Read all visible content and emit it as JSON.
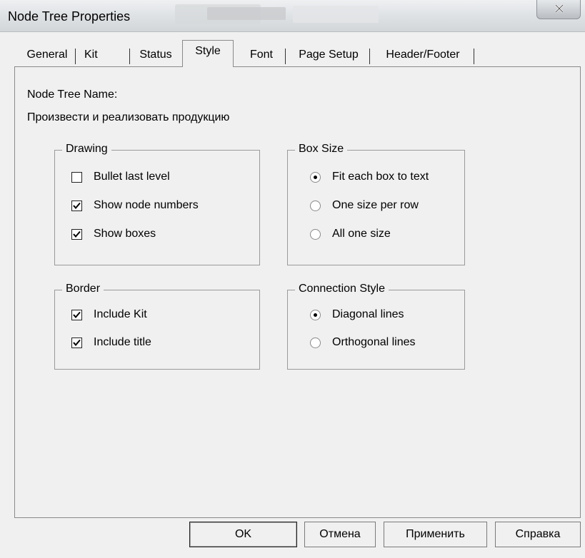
{
  "window": {
    "title": "Node Tree Properties"
  },
  "tabs": [
    {
      "label": "General"
    },
    {
      "label": "Kit"
    },
    {
      "label": "Status"
    },
    {
      "label": "Style"
    },
    {
      "label": "Font"
    },
    {
      "label": "Page Setup"
    },
    {
      "label": "Header/Footer"
    }
  ],
  "active_tab": "Style",
  "node_tree": {
    "label": "Node Tree Name:",
    "value": "Произвести и  реализовать продукцию"
  },
  "drawing": {
    "title": "Drawing",
    "options": [
      {
        "label": "Bullet last level",
        "checked": false
      },
      {
        "label": "Show node numbers",
        "checked": true
      },
      {
        "label": "Show boxes",
        "checked": true
      }
    ]
  },
  "box_size": {
    "title": "Box Size",
    "options": [
      {
        "label": "Fit each box to text",
        "selected": true
      },
      {
        "label": "One size per row",
        "selected": false
      },
      {
        "label": "All one size",
        "selected": false
      }
    ]
  },
  "border": {
    "title": "Border",
    "options": [
      {
        "label": "Include Kit",
        "checked": true
      },
      {
        "label": "Include title",
        "checked": true
      }
    ]
  },
  "connection_style": {
    "title": "Connection Style",
    "options": [
      {
        "label": "Diagonal lines",
        "selected": true
      },
      {
        "label": "Orthogonal lines",
        "selected": false
      }
    ]
  },
  "buttons": {
    "ok": "OK",
    "cancel": "Отмена",
    "apply": "Применить",
    "help": "Справка"
  }
}
